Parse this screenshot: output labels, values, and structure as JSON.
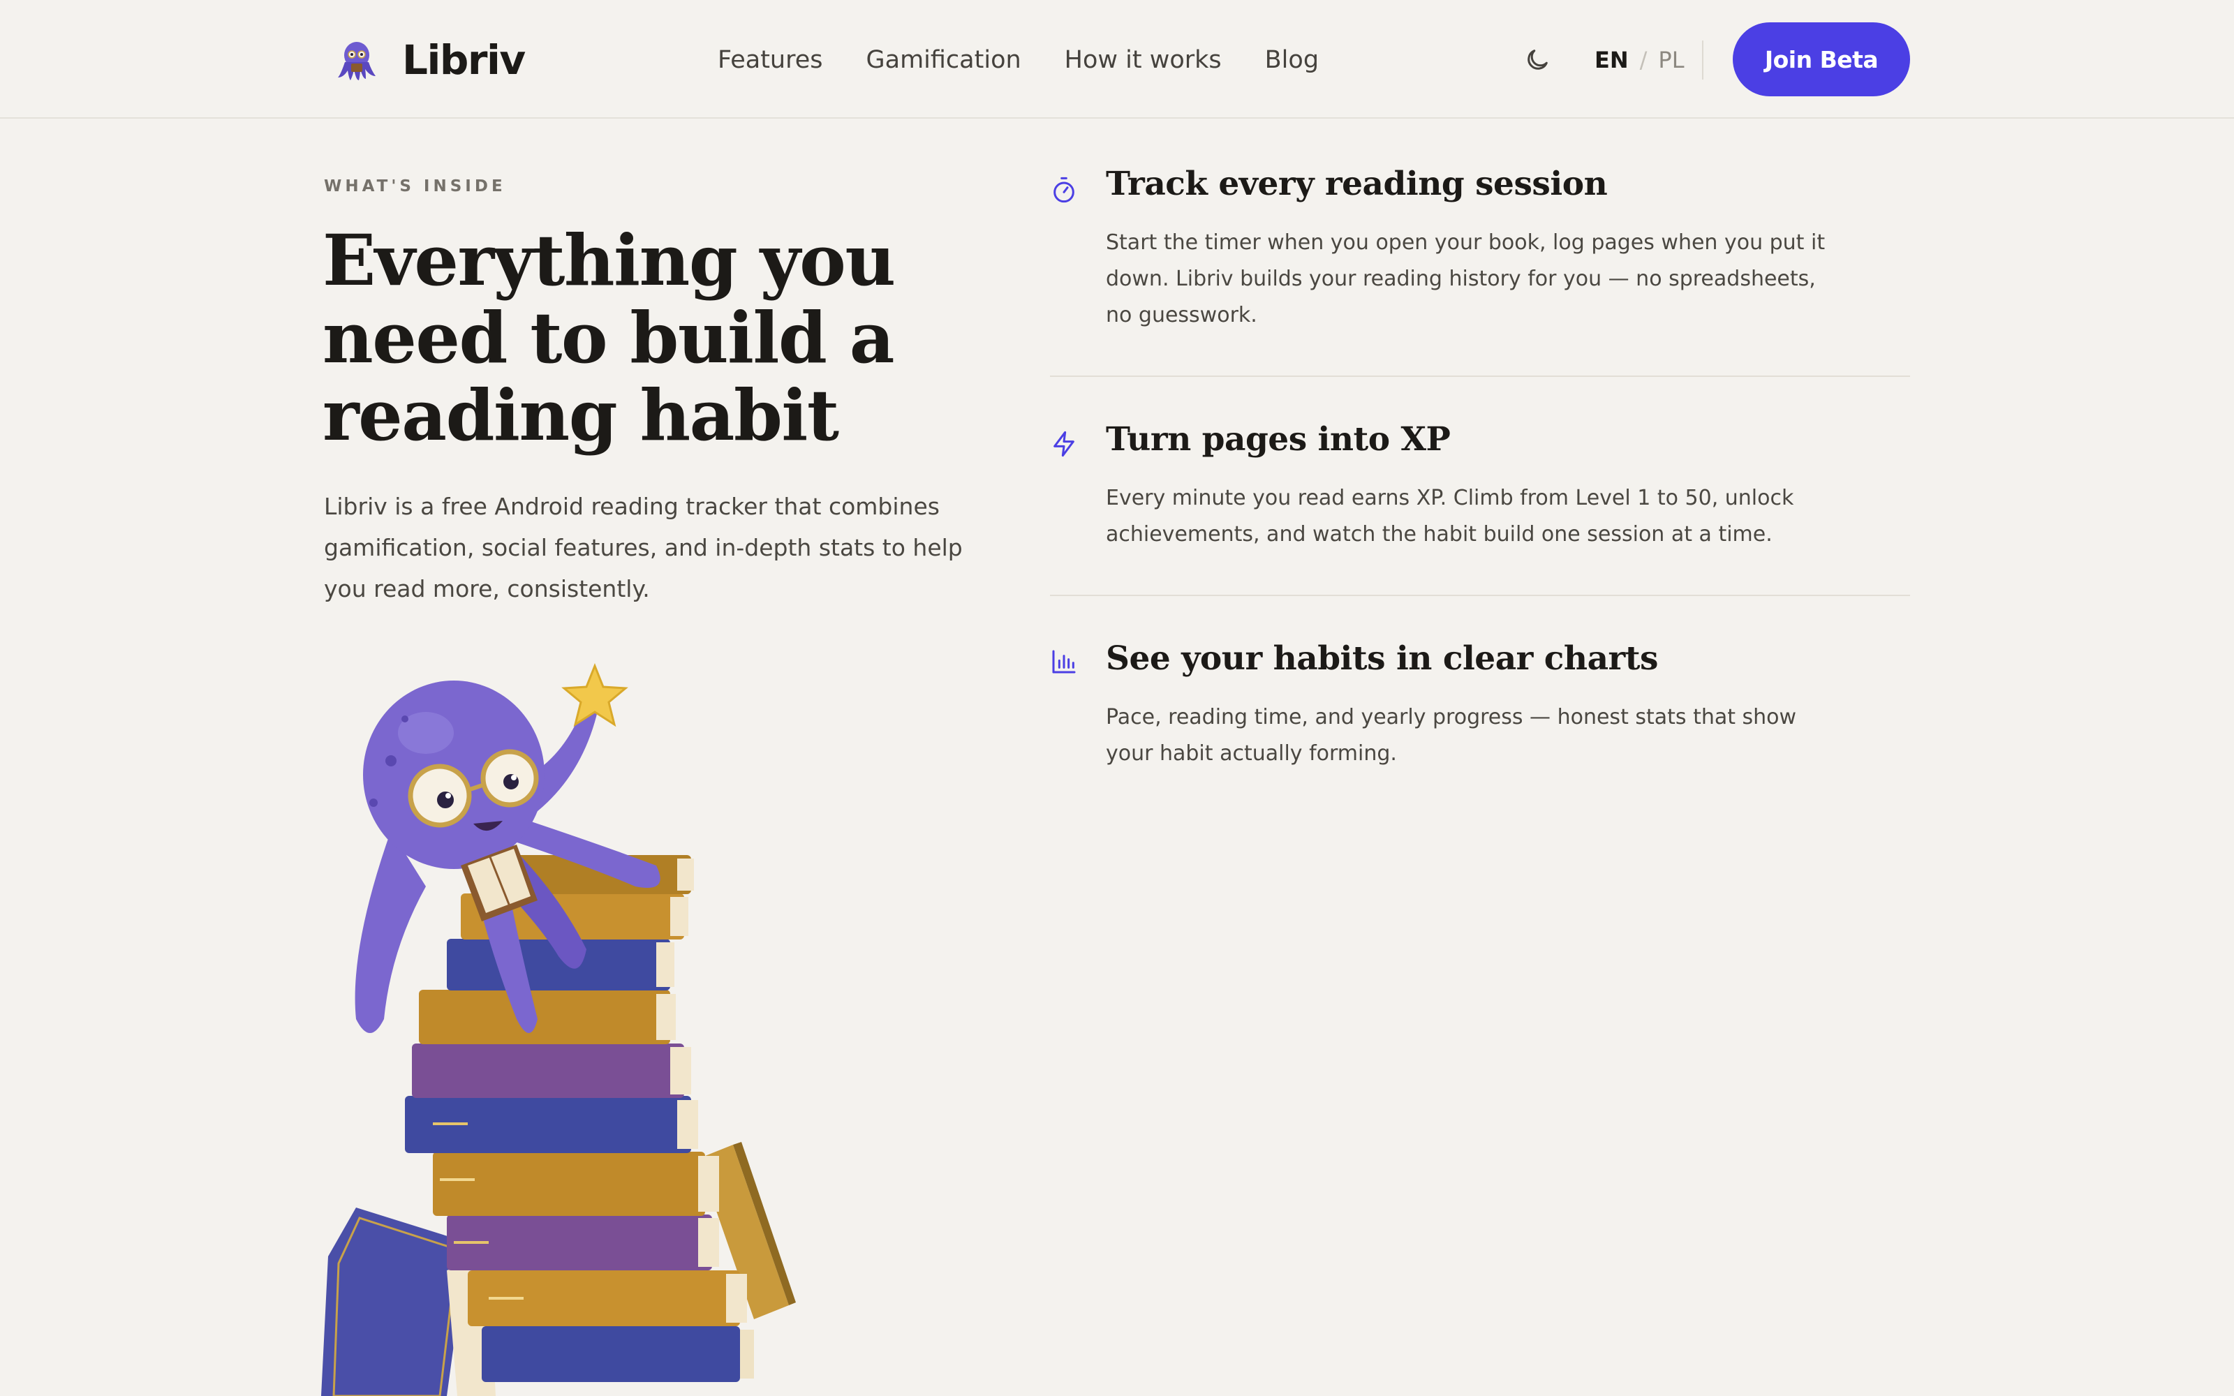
{
  "header": {
    "brand": "Libriv",
    "nav": [
      "Features",
      "Gamification",
      "How it works",
      "Blog"
    ],
    "theme_icon": "moon-icon",
    "lang_active": "EN",
    "lang_separator": "/",
    "lang_inactive": "PL",
    "cta": "Join Beta",
    "accent_color": "#4b3fe4"
  },
  "hero": {
    "eyebrow": "WHAT'S INSIDE",
    "title": "Everything you need to build a reading habit",
    "subtitle": "Libriv is a free Android reading tracker that combines gamification, social features, and in-depth stats to help you read more, consistently.",
    "illustration_icon": "octopus-reading-on-books-illustration"
  },
  "features": [
    {
      "icon": "stopwatch-icon",
      "title": "Track every reading session",
      "description": "Start the timer when you open your book, log pages when you put it down. Libriv builds your reading history for you — no spreadsheets, no guesswork."
    },
    {
      "icon": "lightning-icon",
      "title": "Turn pages into XP",
      "description": "Every minute you read earns XP. Climb from Level 1 to 50, unlock achievements, and watch the habit build one session at a time."
    },
    {
      "icon": "bar-chart-icon",
      "title": "See your habits in clear charts",
      "description": "Pace, reading time, and yearly progress — honest stats that show your habit actually forming."
    }
  ]
}
